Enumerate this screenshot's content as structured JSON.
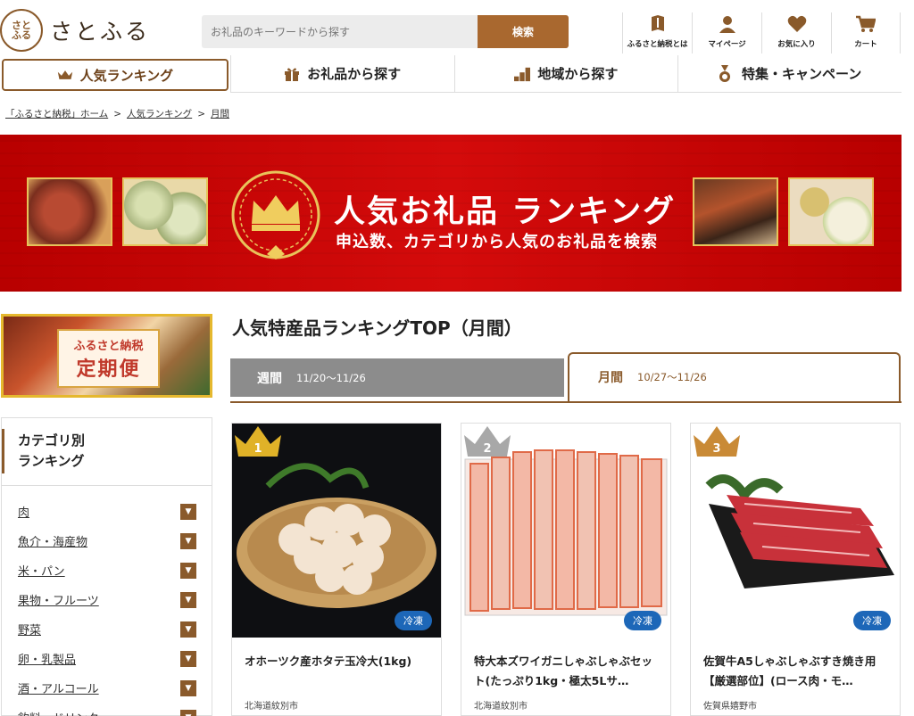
{
  "header": {
    "logo_seal": "さとふる",
    "logo_text": "さとふる",
    "search_placeholder": "お礼品のキーワードから探す",
    "search_button": "検索",
    "nav": [
      {
        "label": "ふるさと納税とは",
        "icon": "book-icon"
      },
      {
        "label": "マイページ",
        "icon": "user-icon"
      },
      {
        "label": "お気に入り",
        "icon": "heart-icon"
      },
      {
        "label": "カート",
        "icon": "cart-icon"
      }
    ]
  },
  "main_nav": [
    {
      "label": "人気ランキング",
      "icon": "crown-icon",
      "active": true
    },
    {
      "label": "お礼品から探す",
      "icon": "gift-icon",
      "active": false
    },
    {
      "label": "地域から探す",
      "icon": "region-icon",
      "active": false
    },
    {
      "label": "特集・キャンペーン",
      "icon": "medal-icon",
      "active": false
    }
  ],
  "breadcrumb": [
    "「ふるさと納税」ホーム",
    "人気ランキング",
    "月間"
  ],
  "banner": {
    "title": "人気お礼品 ランキング",
    "subtitle": "申込数、カテゴリから人気のお礼品を検索"
  },
  "sidebar": {
    "teiki_small": "ふるさと納税",
    "teiki_big": "定期便",
    "category_heading_line1": "カテゴリ別",
    "category_heading_line2": "ランキング",
    "categories": [
      "肉",
      "魚介・海産物",
      "米・パン",
      "果物・フルーツ",
      "野菜",
      "卵・乳製品",
      "酒・アルコール",
      "飲料・ドリンク"
    ]
  },
  "ranking": {
    "title": "人気特産品ランキングTOP（月間）",
    "tabs": [
      {
        "label": "週間",
        "dates": "11/20〜11/26",
        "active": false
      },
      {
        "label": "月間",
        "dates": "10/27〜11/26",
        "active": true
      }
    ],
    "items": [
      {
        "rank": "1",
        "title": "オホーツク産ホタテ玉冷大(1kg)",
        "location": "北海道紋別市",
        "badge": "冷凍",
        "crown_color": "#e0b228"
      },
      {
        "rank": "2",
        "title": "特大本ズワイガニしゃぶしゃぶセット(たっぷり1kg・極太5Lサ…",
        "location": "北海道紋別市",
        "badge": "冷凍",
        "crown_color": "#a8a8a8"
      },
      {
        "rank": "3",
        "title": "佐賀牛A5しゃぶしゃぶすき焼き用【厳選部位】(ロース肉・モ…",
        "location": "佐賀県嬉野市",
        "badge": "冷凍",
        "crown_color": "#c98a36"
      }
    ]
  },
  "colors": {
    "brand": "#8a5a2b",
    "banner_red": "#c8070c",
    "freeze_blue": "#1d67b8"
  }
}
